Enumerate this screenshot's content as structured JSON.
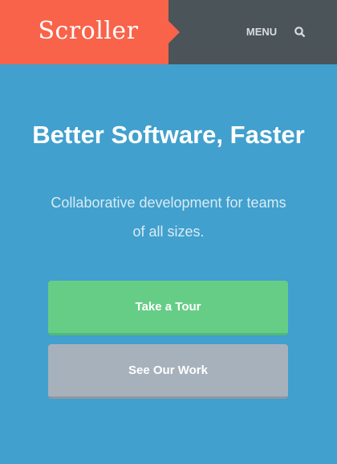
{
  "header": {
    "brand": "Scroller",
    "menu_label": "MENU",
    "search_icon": "search-icon"
  },
  "hero": {
    "title": "Better Software, Faster",
    "subtitle": "Collaborative development for teams of all sizes."
  },
  "actions": {
    "tour_label": "Take a Tour",
    "work_label": "See Our Work"
  },
  "colors": {
    "background": "#41a0cd",
    "header_bar": "#4b5458",
    "brand": "#f8634a",
    "primary_button": "#66cd86",
    "secondary_button": "#a7b1bb"
  }
}
